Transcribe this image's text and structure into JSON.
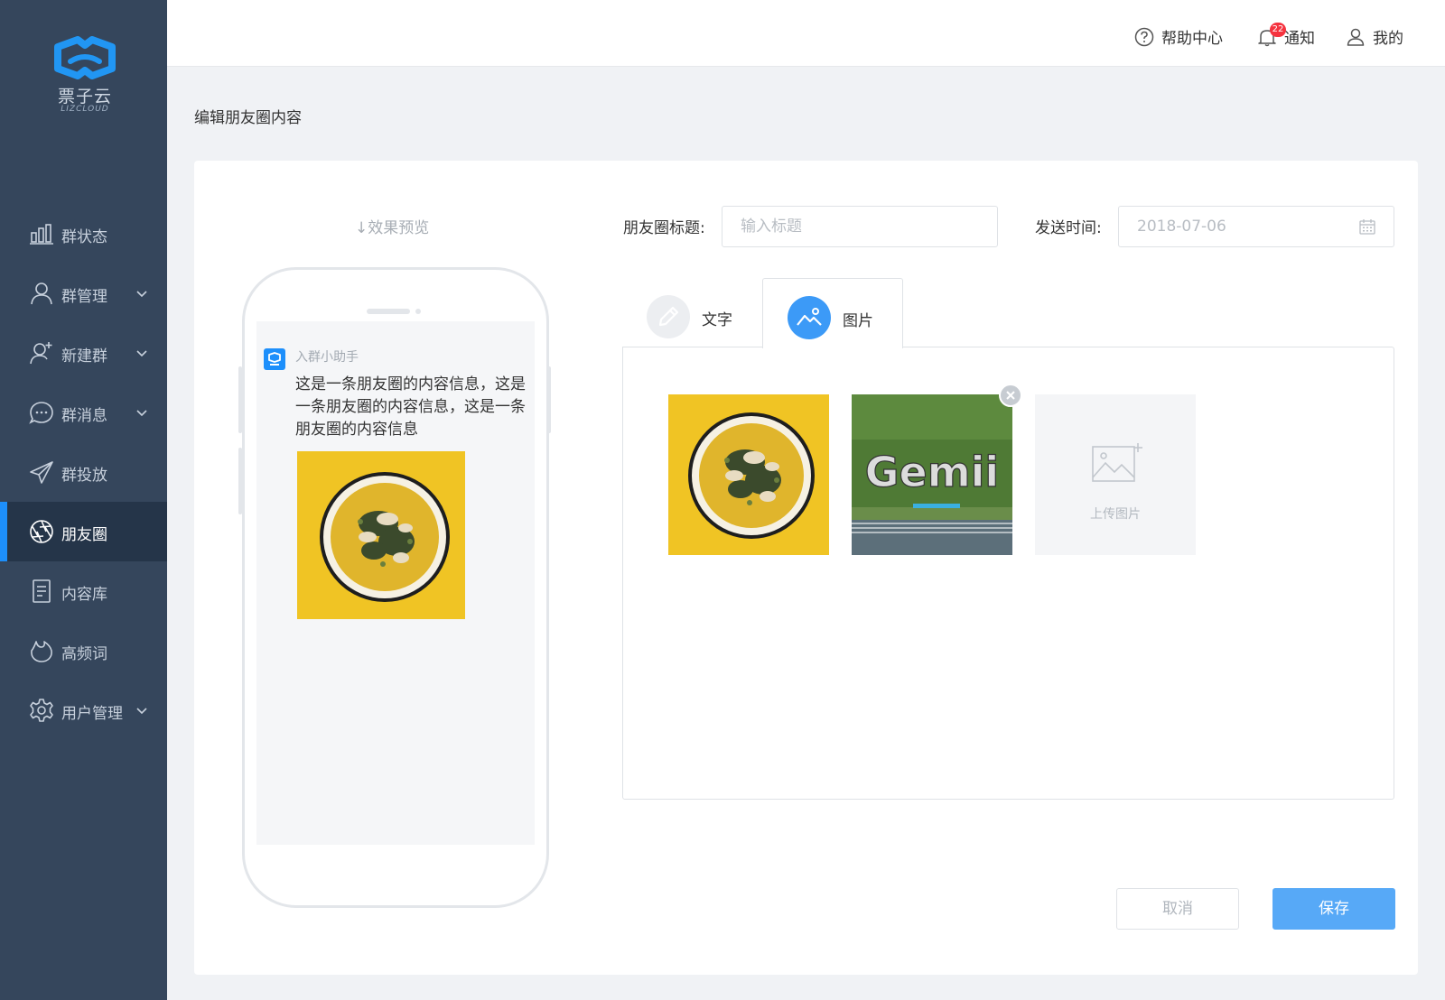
{
  "brand": {
    "name": "票子云",
    "sub": "LIZCLOUD",
    "color": "#1d8ffb"
  },
  "header": {
    "help": "帮助中心",
    "notify": "通知",
    "notify_count": "22",
    "mine": "我的"
  },
  "sidebar": {
    "items": [
      {
        "label": "群状态",
        "icon": "bar-chart-icon",
        "chevron": false
      },
      {
        "label": "群管理",
        "icon": "user-icon",
        "chevron": true
      },
      {
        "label": "新建群",
        "icon": "user-add-icon",
        "chevron": true
      },
      {
        "label": "群消息",
        "icon": "chat-bubble-icon",
        "chevron": true
      },
      {
        "label": "群投放",
        "icon": "paper-plane-icon",
        "chevron": false
      },
      {
        "label": "朋友圈",
        "icon": "aperture-icon",
        "chevron": false,
        "active": true
      },
      {
        "label": "内容库",
        "icon": "document-icon",
        "chevron": false
      },
      {
        "label": "高频词",
        "icon": "fire-icon",
        "chevron": false
      },
      {
        "label": "用户管理",
        "icon": "gear-icon",
        "chevron": true
      }
    ]
  },
  "page": {
    "title": "编辑朋友圈内容"
  },
  "preview": {
    "label": "↓效果预览",
    "poster": "入群小助手",
    "text": "这是一条朋友圈的内容信息，这是一条朋友圈的内容信息，这是一条朋友圈的内容信息"
  },
  "form": {
    "title_label": "朋友圈标题:",
    "title_placeholder": "输入标题",
    "time_label": "发送时间:",
    "time_value": "2018-07-06"
  },
  "tabs": [
    {
      "label": "文字",
      "icon": "pencil-icon"
    },
    {
      "label": "图片",
      "icon": "image-icon",
      "active": true
    }
  ],
  "upload": {
    "label": "上传图片"
  },
  "buttons": {
    "cancel": "取消",
    "save": "保存"
  },
  "thumb2_text": "Gemii"
}
